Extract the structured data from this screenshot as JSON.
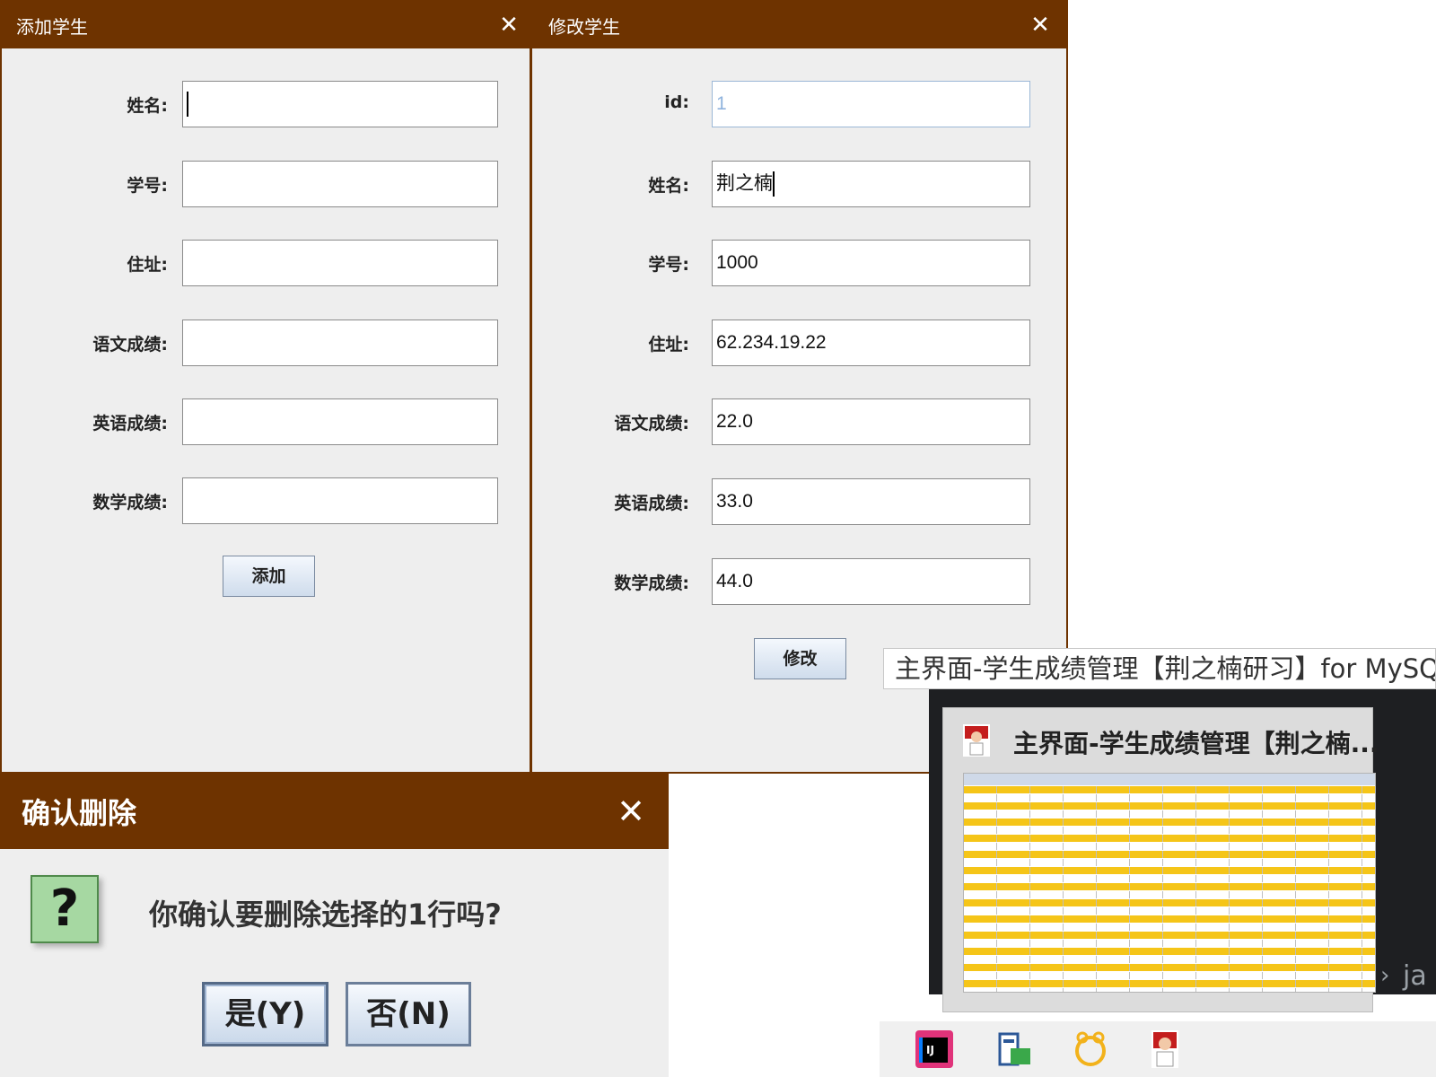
{
  "add_dialog": {
    "title": "添加学生",
    "close": "✕",
    "fields": [
      {
        "label": "姓名:",
        "value": ""
      },
      {
        "label": "学号:",
        "value": ""
      },
      {
        "label": "住址:",
        "value": ""
      },
      {
        "label": "语文成绩:",
        "value": ""
      },
      {
        "label": "英语成绩:",
        "value": ""
      },
      {
        "label": "数学成绩:",
        "value": ""
      }
    ],
    "submit_label": "添加"
  },
  "edit_dialog": {
    "title": "修改学生",
    "close": "✕",
    "fields": [
      {
        "label": "id:",
        "value": "1"
      },
      {
        "label": "姓名:",
        "value": "荆之楠"
      },
      {
        "label": "学号:",
        "value": "1000"
      },
      {
        "label": "住址:",
        "value": "62.234.19.22"
      },
      {
        "label": "语文成绩:",
        "value": "22.0"
      },
      {
        "label": "英语成绩:",
        "value": "33.0"
      },
      {
        "label": "数学成绩:",
        "value": "44.0"
      }
    ],
    "submit_label": "修改"
  },
  "confirm_dialog": {
    "title": "确认删除",
    "close": "✕",
    "icon": "question-icon",
    "icon_glyph": "?",
    "message": "你确认要删除选择的1行吗?",
    "yes_label": "是(Y)",
    "no_label": "否(N)"
  },
  "taskbar_preview": {
    "tooltip": "主界面-学生成绩管理【荆之楠研习】for MySQL",
    "card_title": "主界面-学生成绩管理【荆之楠...",
    "side_text": "ja",
    "taskbar_icons": [
      "intellij-icon",
      "database-tool-icon",
      "navicat-icon",
      "app-avatar-icon"
    ]
  },
  "colors": {
    "title_bar": "#6e3300",
    "highlight_row": "#f5c518"
  }
}
